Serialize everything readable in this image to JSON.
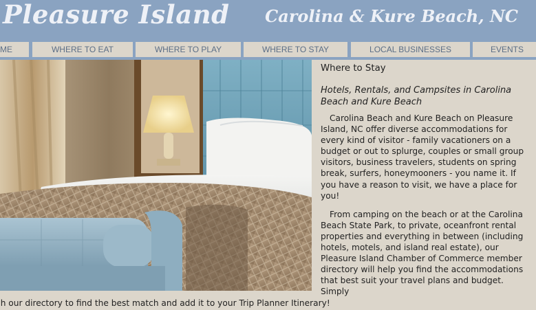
{
  "header": {
    "site_title": "Pleasure Island",
    "location": "Carolina & Kure Beach, NC",
    "header_color": "#8aa3c1"
  },
  "nav": {
    "items": [
      {
        "label": "ME"
      },
      {
        "label": "WHERE TO EAT"
      },
      {
        "label": "WHERE TO PLAY"
      },
      {
        "label": "WHERE TO STAY"
      },
      {
        "label": "LOCAL BUSINESSES"
      },
      {
        "label": "EVENTS"
      }
    ]
  },
  "main": {
    "heading": "Where to Stay",
    "subheading": "Hotels, Rentals, and Campsites in Carolina Beach and Kure Beach",
    "paragraph1": "Carolina Beach and Kure Beach on Pleasure Island, NC offer diverse accommodations for every kind of visitor - family vacationers on a budget or out to splurge, couples or small group visitors, business travelers, students on spring break, surfers, honeymooners - you name it. If you have a reason to visit, we have a place for you!",
    "paragraph2": "From camping on the beach or at the Carolina Beach State Park, to private, oceanfront rental properties and everything in between (including hotels, motels, and island real estate), our Pleasure Island Chamber of Commerce member directory will help you find the accommodations that best suit your travel plans and budget. Simply",
    "overflow_line": "ch our directory to find the best match and add it to your Trip Planner Itinerary!"
  },
  "photo": {
    "subject": "hotel-bedroom-photo"
  }
}
